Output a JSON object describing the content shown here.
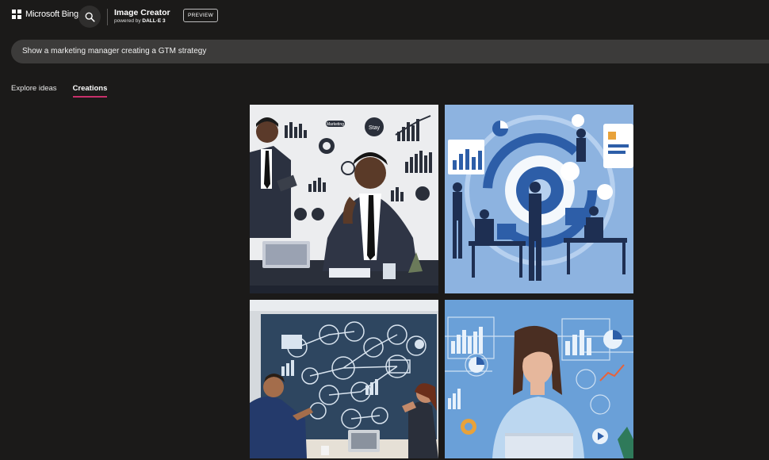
{
  "header": {
    "brand": "Microsoft Bing",
    "product_title": "Image Creator",
    "product_sub_prefix": "powered by ",
    "product_sub_model": "DALL·E 3",
    "preview_badge": "PREVIEW"
  },
  "prompt": {
    "text": "Show a marketing manager creating a GTM strategy"
  },
  "tabs": [
    {
      "label": "Explore ideas",
      "active": false
    },
    {
      "label": "Creations",
      "active": true
    }
  ],
  "images": [
    {
      "description": "Two businessmen with infographics",
      "bubble_text": "Stay",
      "tag_text": "Marketing"
    },
    {
      "description": "Business team with blue gear infographic"
    },
    {
      "description": "Man and woman at a board of icons"
    },
    {
      "description": "Woman with laptop and charts"
    }
  ],
  "colors": {
    "background": "#1b1a19",
    "accent": "#c8306b",
    "prompt_bar": "#3c3b3a"
  }
}
